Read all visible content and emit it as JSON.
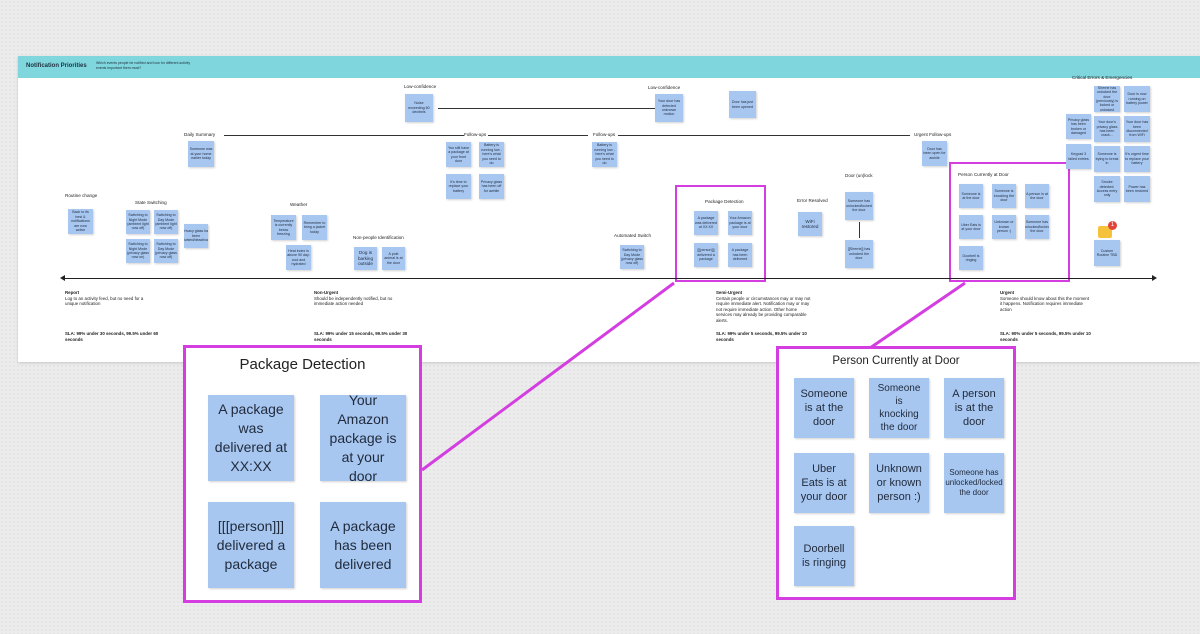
{
  "banner": {
    "title": "Notification Priorities",
    "subtitle": "Which events people be notified and how for different activity events important them most?"
  },
  "board_labels": {
    "low_conf_1": "Low-confidence",
    "low_conf_2": "Low-confidence",
    "daily_summary": "Daily Summary",
    "follow_ups_1": "Follow-ups",
    "follow_ups_2": "Follow-ups",
    "urgent_follow_ups": "Urgent Follow-ups",
    "critical": "Critical Errors & Emergencies",
    "routine_change": "Routine change",
    "state_switching": "State Switching",
    "weather": "Weather",
    "non_people": "Non-people Identification",
    "automated_switch": "Automated Switch",
    "package_detection": "Package Detection",
    "error_resolved": "Error Resolved",
    "door_lock": "Door (un)lock",
    "person_at_door": "Person Currently at Door"
  },
  "board_notes": {
    "noise": "Noise exceeding 60 decibels",
    "low_conf_b": "Your door has detected unknown motion",
    "door_open": "Door has just been opened",
    "someone_home": "Someone was at your home earlier today",
    "fu1": "You still have a package at your front door",
    "fu2": "Battery is running low - here's what you need to do",
    "fu3": "It's time to replace your battery",
    "fu4": "Privacy glass has been off for awhile",
    "fu5": "Battery is running low - here's what you need to do",
    "door_open_awhile": "Door has been open for awhile",
    "rc1": "Back to its best & notifications are now active",
    "ss1": "Switching to Night Mode (ambient light now off)",
    "ss2": "Switching to Day Mode (ambient light now off)",
    "ss3": "Switching to Night Mode (privacy glass now on)",
    "ss4": "Switching to Day Mode (privacy glass now off)",
    "ss5": "Privacy glass has been activated/deactivated",
    "w1": "Temperature is currently below freezing",
    "w2": "Remember to bring a jacket today",
    "w3": "Heat index is above 90 day: cool and hydrated",
    "dog": "Dog is barking outside",
    "pole": "A pole animal is at the door",
    "auto1": "Switching to Day Mode (privacy glass now off)",
    "pd1": "A package was delivered at XX:XX",
    "pd2": "Your Amazon package is at your door",
    "pd3": "[[[person]]] delivered a package",
    "pd4": "A package has been delivered",
    "wifi": "WiFi restored",
    "dl1": "Someone has unlocked/locked the door",
    "dl2": "[[Sherrie]] has unlocked the door",
    "p1": "Someone is at the door",
    "p2": "Someone is knocking the door",
    "p3": "A person is at the door",
    "p4": "Uber Eats is at your door",
    "p5": "Unknown or known person :)",
    "p6": "Someone has unlocked/locked the door",
    "p7": "Doorbell is ringing",
    "c1": "Sherrie has unlocked the door (previously) is locked or unlocked",
    "c2": "Door is now running on battery power",
    "c3": "Privacy glass has been broken or damaged",
    "c4": "Your door's privacy glass has been crack...",
    "c5": "Your door has been disconnected from WiFi",
    "c6": "Keypad 3 failed entries",
    "c7": "Someone is trying to break in",
    "c8": "It's urgent time to replace your battery",
    "c9": "Smoke detected: Access entry only",
    "c10": "Power has been restored",
    "custom": "Custom Routine TBD",
    "badge": "1"
  },
  "tiers": [
    {
      "name": "Report",
      "desc": "Log to an activity feed, but no need for a unique notification",
      "sla": "SLA: 99% under 30 seconds, 99.5% under 60 seconds"
    },
    {
      "name": "Non-Urgent",
      "desc": "Should be independently notified, but no immediate action needed",
      "sla": "SLA: 99% under 15 seconds, 99.5% under 30 seconds"
    },
    {
      "name": "Semi-Urgent",
      "desc": "Certain people or circumstances may or may not require immediate alert. Notification may or may not require immediate action. Other home services may already be providing comparable alerts.",
      "sla": "SLA: 99% under 5 seconds, 99.5% under 10 seconds"
    },
    {
      "name": "Urgent",
      "desc": "Someone should know about this the moment it happens. Notification requires immediate action",
      "sla": "SLA: 90% under 5 seconds, 99.5% under 10 seconds"
    }
  ],
  "zoom_package": {
    "title": "Package Detection",
    "notes": [
      "A package was delivered at XX:XX",
      "Your Amazon package is at your door",
      "[[[person]]] delivered a package",
      "A package has been delivered"
    ]
  },
  "zoom_person": {
    "title": "Person Currently at Door",
    "notes": [
      "Someone is at the door",
      "Someone is knocking the door",
      "A  person is at the door",
      "Uber Eats is at your door",
      "Unknown or known person :)",
      "Someone has unlocked/locked the door",
      "Doorbell is ringing"
    ]
  },
  "colors": {
    "note": "#a8c7f0",
    "highlight": "#d43ee0",
    "banner": "#7fd6dc"
  }
}
